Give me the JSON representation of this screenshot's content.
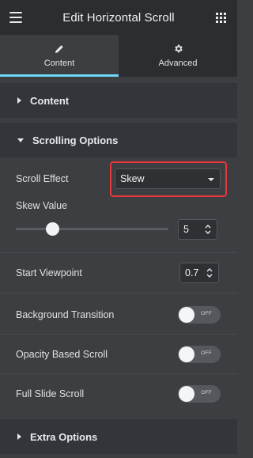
{
  "header": {
    "title": "Edit Horizontal Scroll"
  },
  "tabs": [
    {
      "label": "Content",
      "icon": "pencil-icon",
      "active": true
    },
    {
      "label": "Advanced",
      "icon": "gear-icon",
      "active": false
    }
  ],
  "sections": {
    "content": "Content",
    "scrolling": "Scrolling Options",
    "extra": "Extra Options"
  },
  "controls": {
    "scroll_effect": {
      "label": "Scroll Effect",
      "value": "Skew"
    },
    "skew_value": {
      "label": "Skew Value",
      "value": "5",
      "slider_fraction": 0.24
    },
    "start_viewpoint": {
      "label": "Start Viewpoint",
      "value": "0.7"
    },
    "background_transition": {
      "label": "Background Transition",
      "state": "OFF"
    },
    "opacity_scroll": {
      "label": "Opacity Based Scroll",
      "state": "OFF"
    },
    "full_slide": {
      "label": "Full Slide Scroll",
      "state": "OFF"
    }
  },
  "colors": {
    "accent": "#71d7f7",
    "highlight": "#e5373c",
    "panel": "#3d3e41",
    "header": "#2c2d30"
  }
}
